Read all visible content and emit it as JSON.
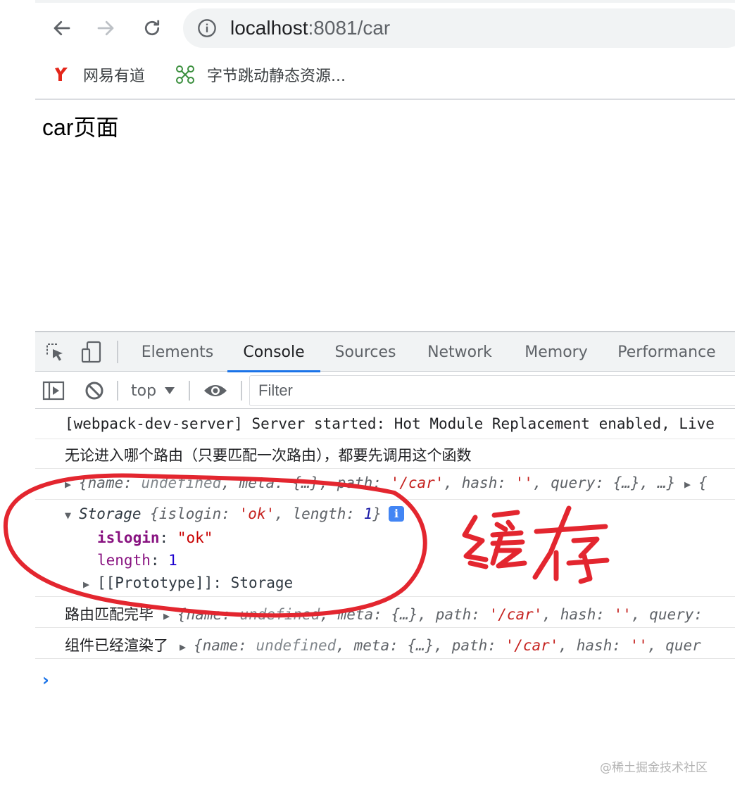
{
  "browser": {
    "url_host": "localhost",
    "url_rest": ":8081/car",
    "bookmarks": [
      {
        "label": "网易有道",
        "icon": "youdao-icon"
      },
      {
        "label": "字节跳动静态资源...",
        "icon": "bytedance-node-icon"
      }
    ]
  },
  "page": {
    "heading": "car页面"
  },
  "devtools": {
    "tabs": [
      "Elements",
      "Console",
      "Sources",
      "Network",
      "Memory",
      "Performance"
    ],
    "active_tab": "Console",
    "toolbar": {
      "context": "top",
      "filter_placeholder": "Filter"
    },
    "console": {
      "line1": "[webpack-dev-server] Server started: Hot Module Replacement enabled, Live",
      "line2": "无论进入哪个路由（只要匹配一次路由），都要先调用这个函数",
      "route_obj": {
        "open": "{",
        "name_key": "name",
        "name_val": "undefined",
        "meta_key": "meta",
        "meta_val": "{…}",
        "path_key": "path",
        "path_val": "'/car'",
        "hash_key": "hash",
        "hash_val": "''",
        "query_key": "query",
        "query_val": "{…}",
        "more": "…}",
        "next": "{"
      },
      "storage": {
        "header_type": "Storage",
        "header_open": "{",
        "islogin_key": "islogin",
        "islogin_val": "'ok'",
        "length_key": "length",
        "length_val": "1",
        "header_close": "}",
        "prop_islogin": "islogin",
        "prop_islogin_val": "\"ok\"",
        "prop_length": "length",
        "prop_length_val": "1",
        "prop_proto": "[[Prototype]]",
        "prop_proto_val": "Storage"
      },
      "line_matched": "路由匹配完毕",
      "line_rendered": "组件已经渲染了",
      "query_trunc_1": "query:",
      "query_trunc_2": "quer"
    }
  },
  "annotation": {
    "handwritten": "缓存",
    "color": "#e3262f"
  },
  "watermark": "@稀土掘金技术社区"
}
